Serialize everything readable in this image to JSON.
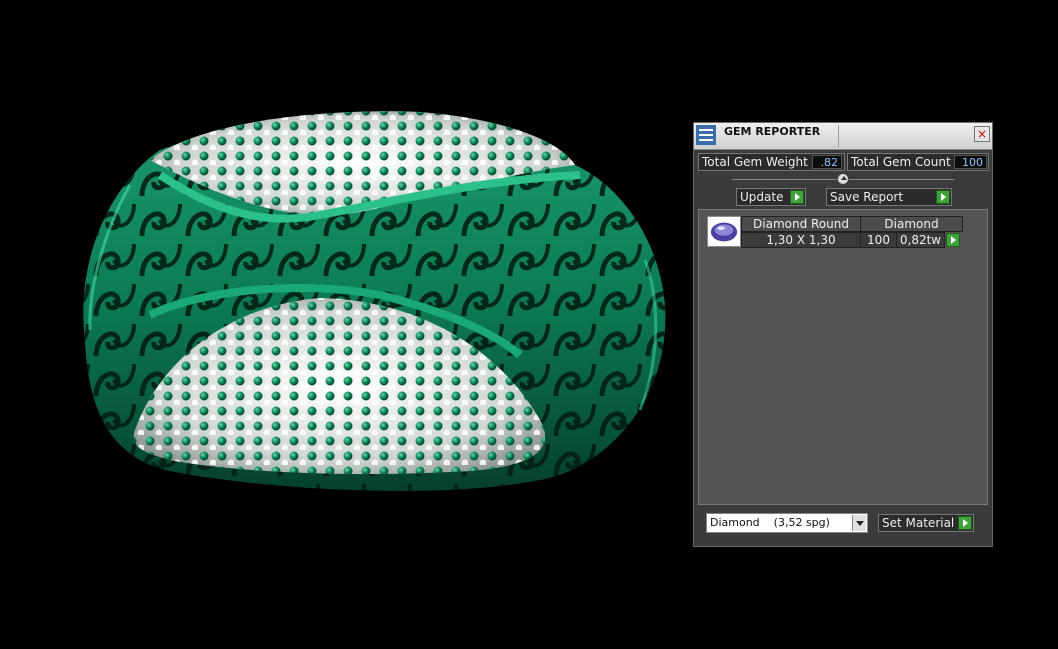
{
  "panel": {
    "title": "GEM REPORTER",
    "close_label": "×",
    "total_gem_weight_label": "Total Gem Weight",
    "total_gem_weight_value": ".82",
    "total_gem_count_label": "Total Gem Count",
    "total_gem_count_value": "100",
    "update_label": "Update",
    "save_report_label": "Save Report",
    "gems": [
      {
        "shape": "Diamond Round",
        "material": "Diamond",
        "size": "1,30 X 1,30",
        "count": "100",
        "weight": "0,82tw"
      }
    ],
    "material_select": {
      "value": "Diamond    (3,52 spg)"
    },
    "set_material_label": "Set Material"
  },
  "colors": {
    "background": "#000000",
    "ring_metal": "#0d7a55",
    "panel_bg": "#3b3b3b",
    "go_button": "#3fa33a",
    "value_text": "#8ec5ff"
  },
  "icons": {
    "title": "gem-reporter-icon",
    "close": "close-icon",
    "go": "play-arrow-icon",
    "thumb": "round-gem-icon",
    "dropdown": "chevron-down-icon"
  }
}
